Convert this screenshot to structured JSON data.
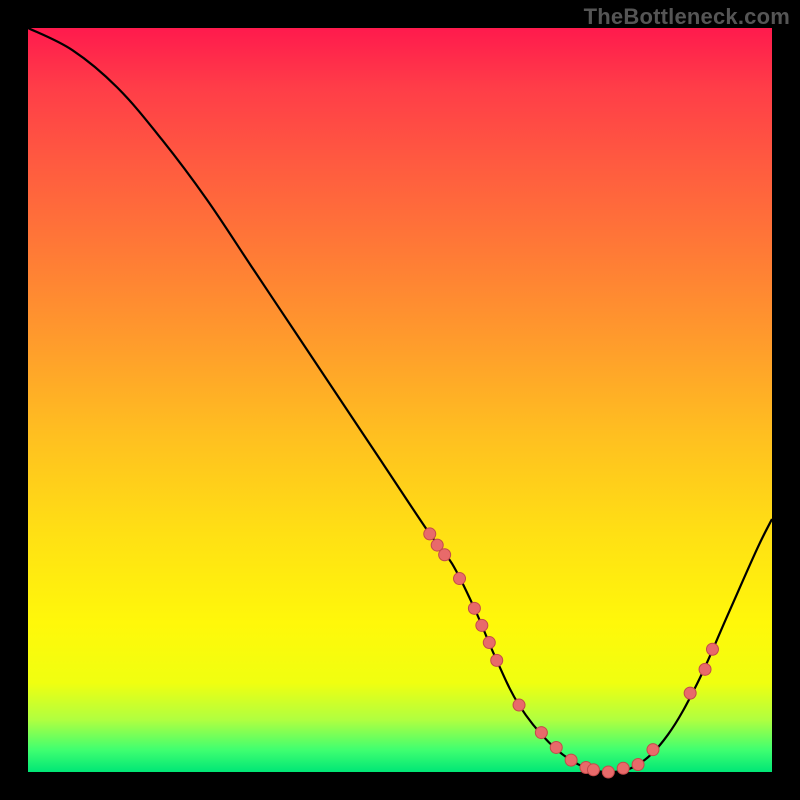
{
  "watermark": "TheBottleneck.com",
  "colors": {
    "background": "#000000",
    "curve": "#000000",
    "marker_fill": "#e86a6a",
    "marker_stroke": "#c44a4a"
  },
  "chart_data": {
    "type": "line",
    "title": "",
    "xlabel": "",
    "ylabel": "",
    "xlim": [
      0,
      100
    ],
    "ylim": [
      0,
      100
    ],
    "x": [
      0,
      6,
      12,
      18,
      24,
      30,
      36,
      42,
      48,
      54,
      57,
      60,
      63,
      66,
      70,
      74,
      78,
      82,
      86,
      90,
      94,
      98,
      100
    ],
    "values": [
      100,
      97,
      92,
      85,
      77,
      68,
      59,
      50,
      41,
      32,
      28,
      22,
      15,
      9,
      4,
      1,
      0,
      1,
      5,
      12,
      21,
      30,
      34
    ],
    "markers": [
      {
        "x": 54,
        "y": 32
      },
      {
        "x": 55,
        "y": 30.5
      },
      {
        "x": 56,
        "y": 29.2
      },
      {
        "x": 58,
        "y": 26
      },
      {
        "x": 60,
        "y": 22
      },
      {
        "x": 61,
        "y": 19.7
      },
      {
        "x": 62,
        "y": 17.4
      },
      {
        "x": 63,
        "y": 15
      },
      {
        "x": 66,
        "y": 9
      },
      {
        "x": 69,
        "y": 5.3
      },
      {
        "x": 71,
        "y": 3.3
      },
      {
        "x": 73,
        "y": 1.6
      },
      {
        "x": 75,
        "y": 0.6
      },
      {
        "x": 76,
        "y": 0.3
      },
      {
        "x": 78,
        "y": 0
      },
      {
        "x": 80,
        "y": 0.5
      },
      {
        "x": 82,
        "y": 1
      },
      {
        "x": 84,
        "y": 3
      },
      {
        "x": 89,
        "y": 10.6
      },
      {
        "x": 91,
        "y": 13.8
      },
      {
        "x": 92,
        "y": 16.5
      }
    ]
  }
}
